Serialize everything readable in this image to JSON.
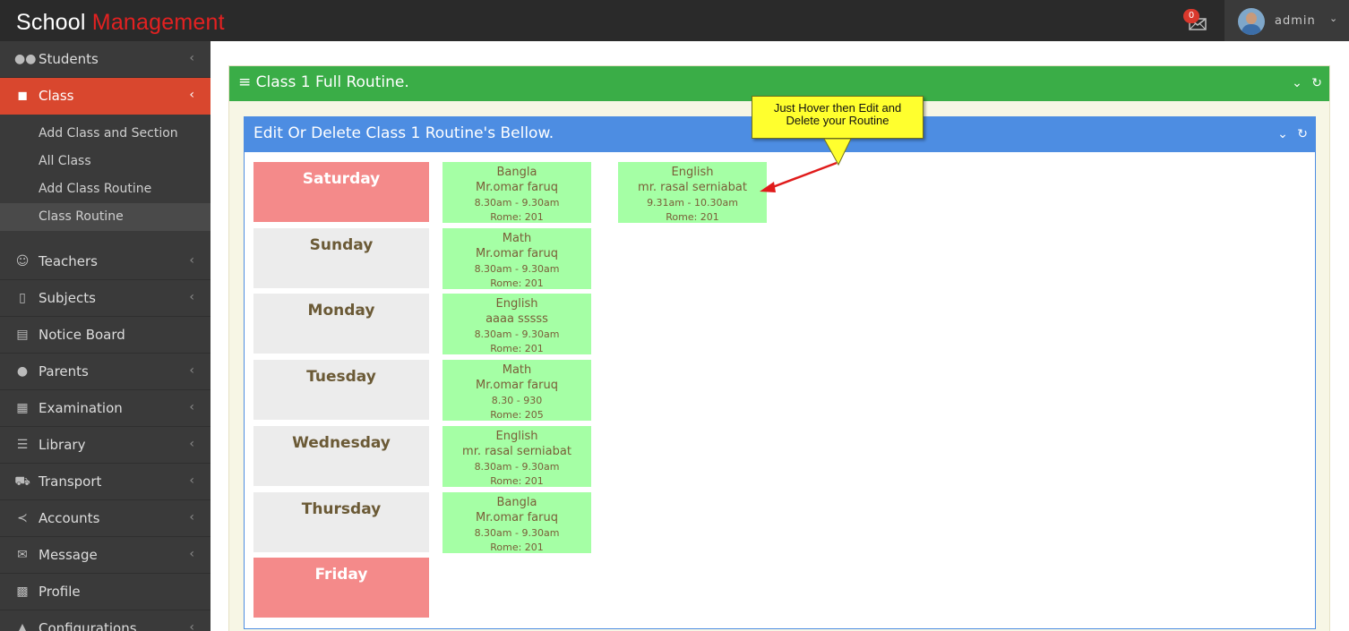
{
  "app": {
    "logo_part1": "School ",
    "logo_part2": "Management",
    "brand_accent": "#e32121"
  },
  "topbar": {
    "mail_icon": "envelope-icon",
    "mail_count": "0",
    "username": "admin",
    "user_menu_icon": "chevron-down-icon"
  },
  "sidebar": {
    "items": [
      {
        "label": "Students",
        "icon": "users-icon"
      },
      {
        "label": "Class",
        "icon": "cubes-icon",
        "active": true
      },
      {
        "label": "Teachers",
        "icon": "user-outline-icon"
      },
      {
        "label": "Subjects",
        "icon": "book-icon"
      },
      {
        "label": "Notice Board",
        "icon": "clipboard-icon"
      },
      {
        "label": "Parents",
        "icon": "user-icon"
      },
      {
        "label": "Examination",
        "icon": "table-icon"
      },
      {
        "label": "Library",
        "icon": "bars-icon"
      },
      {
        "label": "Transport",
        "icon": "truck-icon"
      },
      {
        "label": "Accounts",
        "icon": "share-icon"
      },
      {
        "label": "Message",
        "icon": "envelope-open-icon"
      },
      {
        "label": "Profile",
        "icon": "qrcode-icon"
      },
      {
        "label": "Configurations",
        "icon": "graduation-cap-icon"
      }
    ],
    "class_submenu": [
      {
        "label": "Add Class and Section"
      },
      {
        "label": "All Class"
      },
      {
        "label": "Add Class Routine"
      },
      {
        "label": "Class Routine",
        "current": true
      }
    ]
  },
  "outer_panel": {
    "title": "Class 1 Full Routine.",
    "color": "#3aad47"
  },
  "inner_panel": {
    "title": "Edit Or Delete Class 1 Routine's Bellow.",
    "color": "#4d8de2"
  },
  "routine": {
    "days": [
      {
        "name": "Saturday",
        "weekend": true
      },
      {
        "name": "Sunday",
        "weekend": false
      },
      {
        "name": "Monday",
        "weekend": false
      },
      {
        "name": "Tuesday",
        "weekend": false
      },
      {
        "name": "Wednesday",
        "weekend": false
      },
      {
        "name": "Thursday",
        "weekend": false
      },
      {
        "name": "Friday",
        "weekend": true
      }
    ],
    "slots": [
      [
        {
          "subject": "Bangla",
          "teacher": "Mr.omar faruq",
          "time": "8.30am - 9.30am",
          "room": "Rome: 201"
        },
        {
          "subject": "English",
          "teacher": "mr. rasal serniabat",
          "time": "9.31am - 10.30am",
          "room": "Rome: 201"
        }
      ],
      [
        {
          "subject": "Math",
          "teacher": "Mr.omar faruq",
          "time": "8.30am - 9.30am",
          "room": "Rome: 201"
        }
      ],
      [
        {
          "subject": "English",
          "teacher": "aaaa sssss",
          "time": "8.30am - 9.30am",
          "room": "Rome: 201"
        }
      ],
      [
        {
          "subject": "Math",
          "teacher": "Mr.omar faruq",
          "time": "8.30 - 930",
          "room": "Rome: 205"
        }
      ],
      [
        {
          "subject": "English",
          "teacher": "mr. rasal serniabat",
          "time": "8.30am - 9.30am",
          "room": "Rome: 201"
        }
      ],
      [
        {
          "subject": "Bangla",
          "teacher": "Mr.omar faruq",
          "time": "8.30am - 9.30am",
          "room": "Rome: 201"
        }
      ],
      []
    ],
    "weekend_color": "#f48a8a",
    "slot_color": "#a5ffa5"
  },
  "callout": {
    "line1": "Just Hover then Edit and",
    "line2": "Delete your Routine",
    "color": "#ffff2e",
    "arrow_color": "#e01b1b"
  }
}
